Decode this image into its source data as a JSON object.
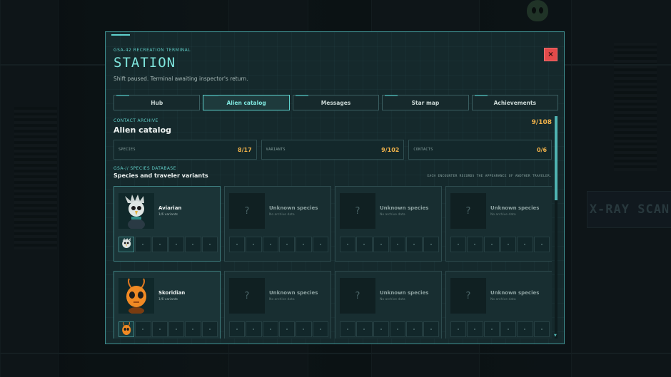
{
  "modal": {
    "eyebrow": "GSA-42 RECREATION TERMINAL",
    "title": "STATION",
    "subtitle": "Shift paused. Terminal awaiting inspector's return.",
    "close_label": "×"
  },
  "tabs": [
    {
      "label": "Hub",
      "active": false
    },
    {
      "label": "Alien catalog",
      "active": true
    },
    {
      "label": "Messages",
      "active": false
    },
    {
      "label": "Star map",
      "active": false
    },
    {
      "label": "Achievements",
      "active": false
    }
  ],
  "catalog": {
    "section_label": "CONTACT ARCHIVE",
    "section_title": "Alien catalog",
    "total": "9/108",
    "stats": [
      {
        "label": "SPECIES",
        "value": "8/17"
      },
      {
        "label": "VARIANTS",
        "value": "9/102"
      },
      {
        "label": "CONTACTS",
        "value": "0/6"
      }
    ],
    "db_label": "GSA-// SPECIES DATABASE",
    "db_title": "Species and traveler variants",
    "db_note": "EACH ENCOUNTER RECORDS THE APPEARANCE OF ANOTHER TRAVELER.",
    "unknown_q": "?",
    "cards": [
      {
        "name": "Aviarian",
        "sub": "1/6 variants",
        "known": true,
        "portrait": "aviarian-portrait"
      },
      {
        "name": "Unknown species",
        "sub": "No archive data",
        "known": false
      },
      {
        "name": "Unknown species",
        "sub": "No archive data",
        "known": false
      },
      {
        "name": "Unknown species",
        "sub": "No archive data",
        "known": false
      },
      {
        "name": "Skoridian",
        "sub": "1/6 variants",
        "known": true,
        "portrait": "skoridian-portrait"
      },
      {
        "name": "Unknown species",
        "sub": "No archive data",
        "known": false
      },
      {
        "name": "Unknown species",
        "sub": "No archive data",
        "known": false
      },
      {
        "name": "Unknown species",
        "sub": "No archive data",
        "known": false
      }
    ]
  },
  "background": {
    "sign_text": "X-RAY SCAN"
  },
  "colors": {
    "accent": "#5fd3cf",
    "highlight": "#f1b24a",
    "close": "#e24a4a"
  }
}
